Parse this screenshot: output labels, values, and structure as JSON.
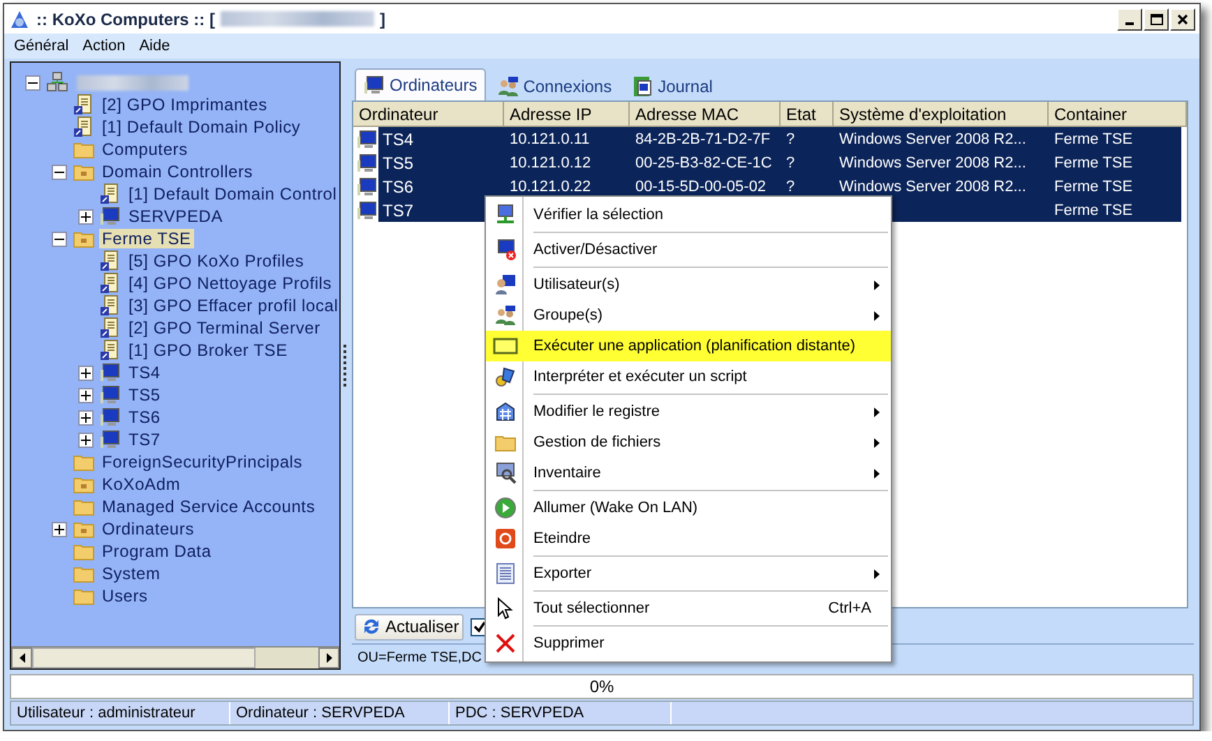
{
  "window": {
    "title": ":: KoXo Computers :: [",
    "title_suffix": "]"
  },
  "menu_bar": [
    {
      "label": "Général"
    },
    {
      "label": "Action"
    },
    {
      "label": "Aide"
    }
  ],
  "tree": {
    "root": {
      "kind": "domain",
      "expanded": true,
      "selected": false,
      "children": [
        {
          "label": "[2] GPO Imprimantes",
          "kind": "gpo",
          "selected": false
        },
        {
          "label": "[1] Default Domain Policy",
          "kind": "gpo",
          "selected": false
        },
        {
          "label": "Computers",
          "kind": "folder",
          "selected": false
        },
        {
          "label": "Domain Controllers",
          "kind": "ou",
          "expanded": true,
          "selected": false,
          "children": [
            {
              "label": "[1] Default Domain Control",
              "kind": "gpo",
              "selected": false
            },
            {
              "label": "SERVPEDA",
              "kind": "computer",
              "expanded": false,
              "selected": false
            }
          ]
        },
        {
          "label": "Ferme TSE",
          "kind": "ou",
          "expanded": true,
          "selected": true,
          "children": [
            {
              "label": "[5] GPO KoXo Profiles",
              "kind": "gpo",
              "selected": false
            },
            {
              "label": "[4] GPO Nettoyage Profils",
              "kind": "gpo",
              "selected": false
            },
            {
              "label": "[3] GPO Effacer profil local",
              "kind": "gpo",
              "selected": false
            },
            {
              "label": "[2] GPO Terminal Server",
              "kind": "gpo",
              "selected": false
            },
            {
              "label": "[1] GPO Broker TSE",
              "kind": "gpo",
              "selected": false
            },
            {
              "label": "TS4",
              "kind": "computer",
              "expanded": false,
              "selected": false
            },
            {
              "label": "TS5",
              "kind": "computer",
              "expanded": false,
              "selected": false
            },
            {
              "label": "TS6",
              "kind": "computer",
              "expanded": false,
              "selected": false
            },
            {
              "label": "TS7",
              "kind": "computer",
              "expanded": false,
              "selected": false
            }
          ]
        },
        {
          "label": "ForeignSecurityPrincipals",
          "kind": "folder",
          "selected": false
        },
        {
          "label": "KoXoAdm",
          "kind": "ou",
          "selected": false
        },
        {
          "label": "Managed Service Accounts",
          "kind": "folder",
          "selected": false
        },
        {
          "label": "Ordinateurs",
          "kind": "ou",
          "expanded": false,
          "selected": false
        },
        {
          "label": "Program Data",
          "kind": "folder",
          "selected": false
        },
        {
          "label": "System",
          "kind": "folder",
          "selected": false
        },
        {
          "label": "Users",
          "kind": "folder",
          "selected": false
        }
      ]
    }
  },
  "tabs": [
    {
      "label": "Ordinateurs",
      "selected": true
    },
    {
      "label": "Connexions",
      "selected": false
    },
    {
      "label": "Journal",
      "selected": false
    }
  ],
  "table": {
    "columns": [
      "Ordinateur",
      "Adresse IP",
      "Adresse MAC",
      "Etat",
      "Système d'exploitation",
      "Container"
    ],
    "rows": [
      {
        "name": "TS4",
        "ip": "10.121.0.11",
        "mac": "84-2B-2B-71-D2-7F",
        "state": "?",
        "os": "Windows Server 2008 R2...",
        "container": "Ferme TSE",
        "selected": true
      },
      {
        "name": "TS5",
        "ip": "10.121.0.12",
        "mac": "00-25-B3-82-CE-1C",
        "state": "?",
        "os": "Windows Server 2008 R2...",
        "container": "Ferme TSE",
        "selected": true
      },
      {
        "name": "TS6",
        "ip": "10.121.0.22",
        "mac": "00-15-5D-00-05-02",
        "state": "?",
        "os": "Windows Server 2008 R2...",
        "container": "Ferme TSE",
        "selected": true
      },
      {
        "name": "TS7",
        "container": "Ferme TSE",
        "selected": true
      }
    ]
  },
  "context_menu": [
    {
      "kind": "item",
      "label": "Vérifier la sélection",
      "submenu": false,
      "selected": false
    },
    {
      "kind": "separator"
    },
    {
      "kind": "item",
      "label": "Activer/Désactiver",
      "submenu": false,
      "selected": false
    },
    {
      "kind": "separator"
    },
    {
      "kind": "item",
      "label": "Utilisateur(s)",
      "submenu": true,
      "selected": false
    },
    {
      "kind": "item",
      "label": "Groupe(s)",
      "submenu": true,
      "selected": false
    },
    {
      "kind": "item",
      "label": "Exécuter une application (planification distante)",
      "submenu": false,
      "selected": true
    },
    {
      "kind": "item",
      "label": "Interpréter et exécuter un script",
      "submenu": false,
      "selected": false
    },
    {
      "kind": "separator"
    },
    {
      "kind": "item",
      "label": "Modifier le registre",
      "submenu": true,
      "selected": false
    },
    {
      "kind": "item",
      "label": "Gestion de fichiers",
      "submenu": true,
      "selected": false
    },
    {
      "kind": "item",
      "label": "Inventaire",
      "submenu": true,
      "selected": false
    },
    {
      "kind": "separator"
    },
    {
      "kind": "item",
      "label": "Allumer (Wake On LAN)",
      "submenu": false,
      "selected": false
    },
    {
      "kind": "item",
      "label": "Eteindre",
      "submenu": false,
      "selected": false
    },
    {
      "kind": "separator"
    },
    {
      "kind": "item",
      "label": "Exporter",
      "submenu": true,
      "selected": false
    },
    {
      "kind": "separator"
    },
    {
      "kind": "item",
      "label": "Tout sélectionner",
      "shortcut": "Ctrl+A",
      "submenu": false,
      "selected": false
    },
    {
      "kind": "separator"
    },
    {
      "kind": "item",
      "label": "Supprimer",
      "submenu": false,
      "selected": false
    }
  ],
  "refresh_button": {
    "label": "Actualiser"
  },
  "option_checkbox": {
    "checked": true
  },
  "path_text": "OU=Ferme TSE,DC",
  "progress": {
    "level": 0,
    "reading": "0%"
  },
  "status_bar": [
    "Utilisateur : administrateur",
    "Ordinateur : SERVPEDA",
    "PDC : SERVPEDA"
  ]
}
